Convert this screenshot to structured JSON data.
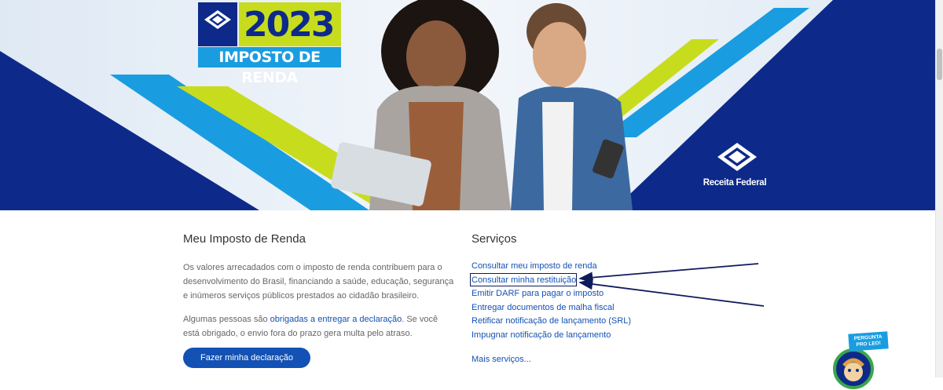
{
  "banner": {
    "year": "2023",
    "subtitle": "IMPOSTO DE RENDA",
    "org_name": "Receita Federal"
  },
  "left": {
    "title": "Meu Imposto de Renda",
    "para1": "Os valores arrecadados com o imposto de renda contribuem para o desenvolvimento do Brasil, financiando a saúde, educação, segurança e inúmeros serviços públicos prestados ao cidadão brasileiro.",
    "para2_before": "Algumas pessoas são ",
    "para2_link": "obrigadas a entregar a declaração",
    "para2_after": ". Se você está obrigado, o envio fora do prazo gera multa pelo atraso.",
    "button_label": "Fazer minha declaração"
  },
  "services": {
    "title": "Serviços",
    "items": [
      "Consultar meu imposto de renda",
      "Consultar minha restituição",
      "Emitir DARF para pagar o imposto",
      "Entregar documentos de malha fiscal",
      "Retificar notificação de lançamento (SRL)",
      "Impugnar notificação de lançamento"
    ],
    "more_label": "Mais serviços..."
  },
  "chat": {
    "tag": "PERGUNTA PRO LEO!"
  },
  "colors": {
    "brand_blue": "#1351b4",
    "navy": "#0d2a8a",
    "lime": "#c8dc1e",
    "sky": "#1a9de0"
  }
}
